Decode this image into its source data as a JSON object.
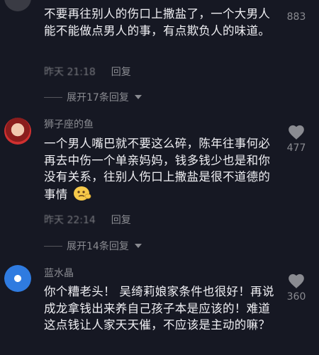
{
  "comments": [
    {
      "username": "",
      "text": "不要再往别人的伤口上撒盐了，一个大男人能不能做点男人的事，有点欺负人的味道。",
      "time": "昨天 21:18",
      "reply_label": "回复",
      "expand_label": "展开17条回复",
      "like_count": "883"
    },
    {
      "username": "狮子座的鱼",
      "text": "一个男人嘴巴就不要这么碎，陈年往事何必再去中伤一个单亲妈妈，钱多钱少也是和你没有关系，往别人伤口上撒盐是很不道德的事情",
      "time": "昨天 22:14",
      "reply_label": "回复",
      "expand_label": "展开14条回复",
      "like_count": "477"
    },
    {
      "username": "蓝水晶",
      "text": "你个糟老头！ 吴绮莉娘家条件也很好！再说成龙拿钱出来养自己孩子本是应该的！难道这点钱让人家天天催，不应该是主动的嘛？",
      "like_count": "360"
    }
  ],
  "colors": {
    "background": "#161823",
    "heart": "#8a8b91"
  },
  "icons": {
    "like": "heart-icon",
    "expand": "caret-down-icon",
    "emoji": "emoji-icon"
  }
}
